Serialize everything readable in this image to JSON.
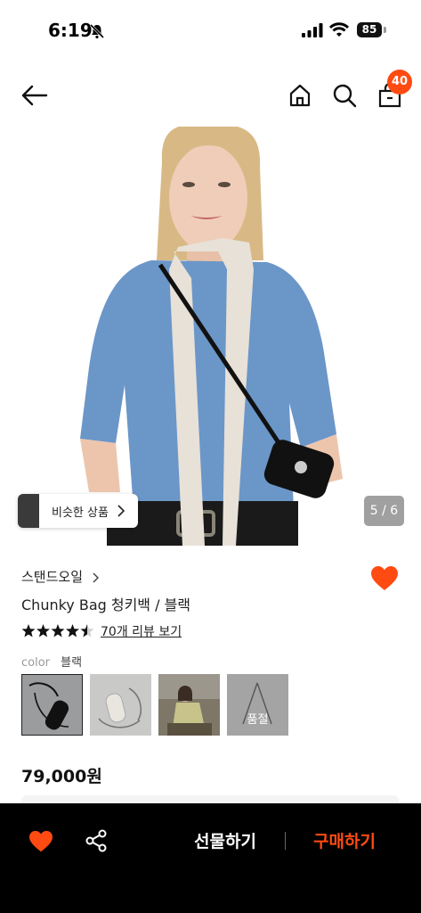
{
  "status_bar": {
    "time": "6:19",
    "battery": "85"
  },
  "header": {
    "cart_count": "40"
  },
  "image": {
    "similar_label": "비슷한 상품",
    "counter": "5 / 6"
  },
  "product": {
    "brand": "스탠드오일",
    "name": "Chunky Bag 청키백 / 블랙",
    "rating": 4.5,
    "review_link": "70개 리뷰 보기",
    "color_label": "color",
    "color_value": "블랙",
    "soldout_label": "품절",
    "price": "79,000원"
  },
  "bottom_bar": {
    "gift_label": "선물하기",
    "buy_label": "구매하기"
  },
  "colors": {
    "accent": "#ff4b12",
    "bar_bg": "#000000",
    "shirt": "#6b96c8"
  },
  "icons": [
    "bell-slash-icon",
    "signal-icon",
    "wifi-icon",
    "back-arrow-icon",
    "home-icon",
    "search-icon",
    "shopping-bag-icon",
    "chevron-right-icon",
    "heart-icon",
    "star-icon",
    "share-icon"
  ]
}
